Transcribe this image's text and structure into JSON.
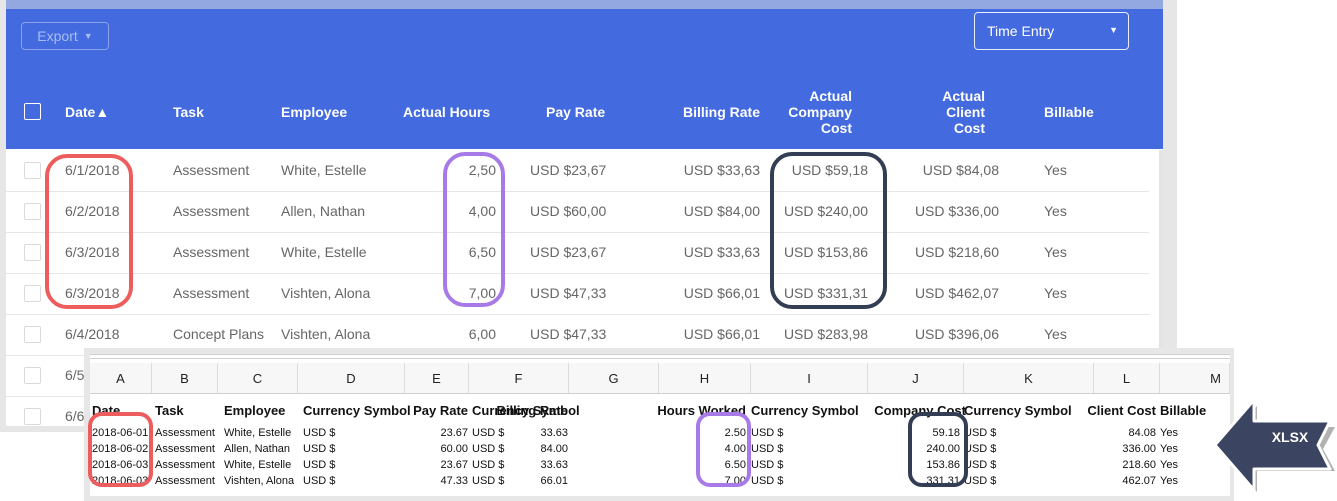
{
  "toolbar": {
    "export_label": "Export",
    "export_caret": "▼",
    "entry_type": "Time Entry",
    "entry_caret": "▼"
  },
  "table": {
    "columns": {
      "date": "Date▲",
      "task": "Task",
      "employee": "Employee",
      "actual_hours": "Actual Hours",
      "pay_rate": "Pay Rate",
      "billing_rate": "Billing Rate",
      "company_cost_1": "Actual",
      "company_cost_2": "Company",
      "company_cost_3": "Cost",
      "client_cost_1": "Actual",
      "client_cost_2": "Client",
      "client_cost_3": "Cost",
      "billable": "Billable"
    },
    "rows": [
      {
        "date": "6/1/2018",
        "task": "Assessment",
        "employee": "White, Estelle",
        "hours": "2,50",
        "pay_rate": "USD $23,67",
        "billing_rate": "USD $33,63",
        "company_cost": "USD $59,18",
        "client_cost": "USD $84,08",
        "billable": "Yes"
      },
      {
        "date": "6/2/2018",
        "task": "Assessment",
        "employee": "Allen, Nathan",
        "hours": "4,00",
        "pay_rate": "USD $60,00",
        "billing_rate": "USD $84,00",
        "company_cost": "USD $240,00",
        "client_cost": "USD $336,00",
        "billable": "Yes"
      },
      {
        "date": "6/3/2018",
        "task": "Assessment",
        "employee": "White, Estelle",
        "hours": "6,50",
        "pay_rate": "USD $23,67",
        "billing_rate": "USD $33,63",
        "company_cost": "USD $153,86",
        "client_cost": "USD $218,60",
        "billable": "Yes"
      },
      {
        "date": "6/3/2018",
        "task": "Assessment",
        "employee": "Vishten, Alona",
        "hours": "7,00",
        "pay_rate": "USD $47,33",
        "billing_rate": "USD $66,01",
        "company_cost": "USD $331,31",
        "client_cost": "USD $462,07",
        "billable": "Yes"
      },
      {
        "date": "6/4/2018",
        "task": "Concept Plans",
        "employee": "Vishten, Alona",
        "hours": "6,00",
        "pay_rate": "USD $47,33",
        "billing_rate": "USD $66,01",
        "company_cost": "USD $283,98",
        "client_cost": "USD $396,06",
        "billable": "Yes"
      },
      {
        "date": "6/5"
      },
      {
        "date": "6/6"
      }
    ]
  },
  "spreadsheet": {
    "column_letters": [
      "A",
      "B",
      "C",
      "D",
      "E",
      "F",
      "G",
      "H",
      "I",
      "J",
      "K",
      "L",
      "M"
    ],
    "headers": [
      "Date",
      "Task",
      "Employee",
      "Currency Symbol",
      "Pay Rate",
      "Currency Symbol",
      "Billing Rate",
      "Hours Worked",
      "Currency Symbol",
      "Company Cost",
      "Currency Symbol",
      "Client Cost",
      "Billable"
    ],
    "rows": [
      [
        "2018-06-01",
        "Assessment",
        "White, Estelle",
        "USD $",
        "23.67",
        "USD $",
        "33.63",
        "2.50",
        "USD $",
        "59.18",
        "USD $",
        "84.08",
        "Yes"
      ],
      [
        "2018-06-02",
        "Assessment",
        "Allen, Nathan",
        "USD $",
        "60.00",
        "USD $",
        "84.00",
        "4.00",
        "USD $",
        "240.00",
        "USD $",
        "336.00",
        "Yes"
      ],
      [
        "2018-06-03",
        "Assessment",
        "White, Estelle",
        "USD $",
        "23.67",
        "USD $",
        "33.63",
        "6.50",
        "USD $",
        "153.86",
        "USD $",
        "218.60",
        "Yes"
      ],
      [
        "2018-06-03",
        "Assessment",
        "Vishten, Alona",
        "USD $",
        "47.33",
        "USD $",
        "66.01",
        "7.00",
        "USD $",
        "331.31",
        "USD $",
        "462.07",
        "Yes"
      ]
    ]
  },
  "callout": {
    "label": "XLSX",
    "color": "#3b4460"
  },
  "colors": {
    "header_bg": "#436ade",
    "highlight_date": "#ee5d5d",
    "highlight_hours": "#a87ae8",
    "highlight_cost": "#333d54"
  }
}
